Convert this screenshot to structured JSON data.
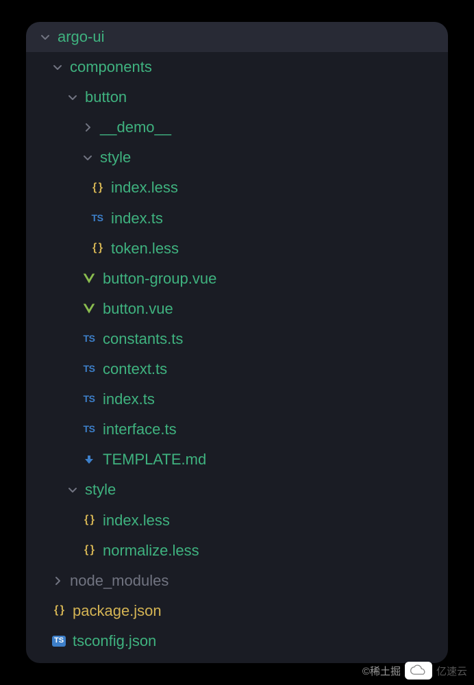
{
  "tree": {
    "root": {
      "label": "argo-ui",
      "expanded": true
    },
    "components": {
      "label": "components",
      "expanded": true
    },
    "button": {
      "label": "button",
      "expanded": true
    },
    "demo": {
      "label": "__demo__",
      "expanded": false
    },
    "style": {
      "label": "style",
      "expanded": true
    },
    "style_index_less": {
      "label": "index.less",
      "icon": "less"
    },
    "style_index_ts": {
      "label": "index.ts",
      "icon": "ts"
    },
    "style_token_less": {
      "label": "token.less",
      "icon": "less"
    },
    "button_group_vue": {
      "label": "button-group.vue",
      "icon": "vue"
    },
    "button_vue": {
      "label": "button.vue",
      "icon": "vue"
    },
    "constants_ts": {
      "label": "constants.ts",
      "icon": "ts"
    },
    "context_ts": {
      "label": "context.ts",
      "icon": "ts"
    },
    "index_ts": {
      "label": "index.ts",
      "icon": "ts"
    },
    "interface_ts": {
      "label": "interface.ts",
      "icon": "ts"
    },
    "template_md": {
      "label": "TEMPLATE.md",
      "icon": "md"
    },
    "style2": {
      "label": "style",
      "expanded": true
    },
    "style2_index_less": {
      "label": "index.less",
      "icon": "less"
    },
    "style2_normalize_less": {
      "label": "normalize.less",
      "icon": "less"
    },
    "node_modules": {
      "label": "node_modules",
      "expanded": false
    },
    "package_json": {
      "label": "package.json",
      "icon": "less"
    },
    "tsconfig_json": {
      "label": "tsconfig.json",
      "icon": "tsconfig"
    }
  },
  "watermark": {
    "text1": "©稀土掘",
    "text2": "亿速云"
  }
}
